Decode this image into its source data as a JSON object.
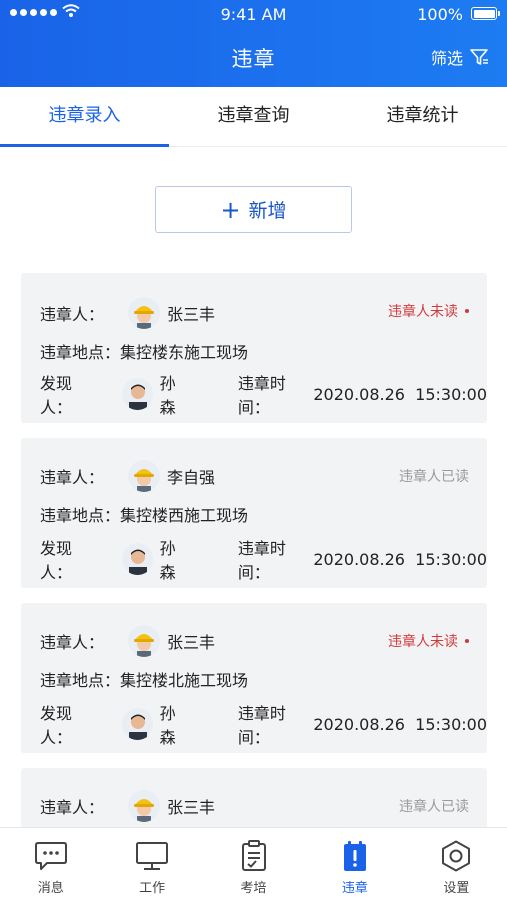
{
  "status_bar": {
    "time": "9:41 AM",
    "battery": "100%"
  },
  "header": {
    "title": "违章",
    "filter_label": "筛选"
  },
  "tabs": [
    {
      "label": "违章录入",
      "active": true
    },
    {
      "label": "违章查询",
      "active": false
    },
    {
      "label": "违章统计",
      "active": false
    }
  ],
  "add_button": {
    "label": "新增"
  },
  "labels": {
    "violator": "违章人：",
    "location": "违章地点：",
    "discoverer": "发现人：",
    "time": "违章时间："
  },
  "records": [
    {
      "violator": "张三丰",
      "location": "集控楼东施工现场",
      "discoverer": "孙森",
      "time": "2020.08.26  15:30:00",
      "status": "违章人未读",
      "unread": true
    },
    {
      "violator": "李自强",
      "location": "集控楼西施工现场",
      "discoverer": "孙森",
      "time": "2020.08.26  15:30:00",
      "status": "违章人已读",
      "unread": false
    },
    {
      "violator": "张三丰",
      "location": "集控楼北施工现场",
      "discoverer": "孙森",
      "time": "2020.08.26  15:30:00",
      "status": "违章人未读",
      "unread": true
    },
    {
      "violator": "张三丰",
      "location": "",
      "discoverer": "",
      "time": "",
      "status": "违章人已读",
      "unread": false
    }
  ],
  "bottom_nav": [
    {
      "label": "消息",
      "icon": "message-icon",
      "active": false
    },
    {
      "label": "工作",
      "icon": "monitor-icon",
      "active": false
    },
    {
      "label": "考培",
      "icon": "clipboard-icon",
      "active": false
    },
    {
      "label": "违章",
      "icon": "violation-icon",
      "active": true
    },
    {
      "label": "设置",
      "icon": "settings-icon",
      "active": false
    }
  ],
  "colors": {
    "primary": "#1a63e8",
    "unread": "#d23a3a",
    "read": "#9a9a9a",
    "card_bg": "#f2f3f5"
  }
}
